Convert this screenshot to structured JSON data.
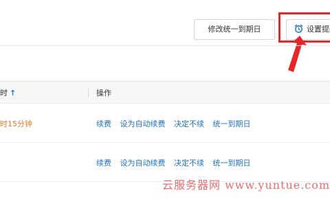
{
  "toolbar": {
    "unify_expiry_label": "修改统一到期日",
    "remind_label": "设置提醒"
  },
  "table": {
    "sort_column_tail": "时",
    "sort_arrow": "↑",
    "ops_header": "操作"
  },
  "rows": [
    {
      "time_left": "时15分钟",
      "actions": [
        "续费",
        "设为自动续费",
        "决定不续",
        "统一到期日"
      ]
    },
    {
      "time_left": "",
      "actions": [
        "续费",
        "设为自动续费",
        "决定不续",
        "统一到期日"
      ]
    }
  ],
  "watermark": "云服务器网 www.yuntue.com",
  "colors": {
    "link": "#1e73be",
    "warning": "#f07a23",
    "highlight": "#e8262a"
  }
}
